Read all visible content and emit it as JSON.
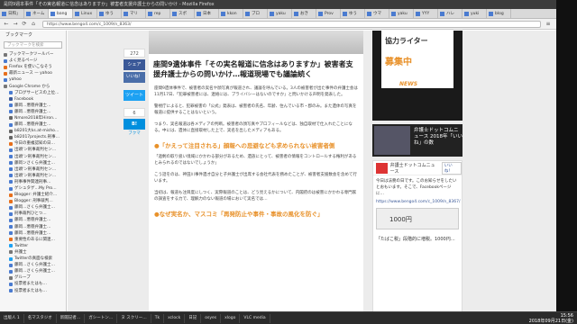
{
  "window": {
    "title": "是問9週本事件「その実名報道に信念はありますか」被害者支援弁護士からの問いかけ - Mozilla Firefox"
  },
  "tabs": [
    "日和」",
    "ネーム",
    "bang",
    "Linux",
    "ゆう",
    "マリ",
    "rep",
    "スポ",
    "日本",
    "kkon",
    "ブロ",
    "yaku",
    "おき",
    "Prov",
    "ゆう",
    "ウマ",
    "yaku",
    "YYY",
    "ハレ",
    "yuki",
    "blog"
  ],
  "nav": {
    "url": "https://www.bengo4.com/c_1009/n_8363/",
    "back": "←",
    "forward": "→",
    "reload": "⟳",
    "home": "⌂",
    "menu": "≡"
  },
  "sidebar": {
    "title": "ブックマーク",
    "search_placeholder": "ブックマークを検索",
    "items": [
      {
        "label": "ブックマークツールバー",
        "color": "#777"
      },
      {
        "label": "よく見るページ",
        "color": "#4a7bd0"
      },
      {
        "label": "Firefox を使いこなそう",
        "color": "#e76f1c"
      },
      {
        "label": "最新ニュース — yahoo",
        "color": "#e76f1c"
      },
      {
        "label": "yahoo",
        "color": "#4a7bd0"
      },
      {
        "label": "Google Chrome から",
        "color": "#777"
      },
      {
        "label": "ブログサービスの上位…",
        "color": "#4a7bd0"
      },
      {
        "label": "Facebook",
        "color": "#3b5998"
      },
      {
        "label": "藤岡…悪徳弁護士…",
        "color": "#4a7bd0"
      },
      {
        "label": "藤岡…悪徳弁護士…",
        "color": "#4a7bd0"
      },
      {
        "label": "Nmore2018年Hiron…",
        "color": "#666"
      },
      {
        "label": "藤岡…悪徳弁護士…",
        "color": "#4a7bd0"
      },
      {
        "label": "b8201大ks.at-misho…",
        "color": "#666"
      },
      {
        "label": "b82017projects.刑事…",
        "color": "#666"
      },
      {
        "label": "今日の重複認知の日…",
        "color": "#e76f1c"
      },
      {
        "label": "出頭'ン刑事裁判セン…",
        "color": "#4a7bd0"
      },
      {
        "label": "出頭'ン刑事裁判セン…",
        "color": "#4a7bd0"
      },
      {
        "label": "藤岡ンさくら弁護士…",
        "color": "#4a7bd0"
      },
      {
        "label": "出頭'ン刑事裁判セン…",
        "color": "#4a7bd0"
      },
      {
        "label": "出頭'ン刑事裁判セン…",
        "color": "#4a7bd0"
      },
      {
        "label": "刑事事件関連刑事…",
        "color": "#4a7bd0"
      },
      {
        "label": "ゲシュタゲ…My Pro…",
        "color": "#4a7bd0"
      },
      {
        "label": "Blogger: 弁護士紹介…",
        "color": "#e76f1c"
      },
      {
        "label": "Blogger: 刑事裁判…",
        "color": "#e76f1c"
      },
      {
        "label": "藤岡…さくら弁護士…",
        "color": "#4a7bd0"
      },
      {
        "label": "刑事裁判ひとつ…",
        "color": "#4a7bd0"
      },
      {
        "label": "藤岡…悪徳弁護士…",
        "color": "#4a7bd0"
      },
      {
        "label": "藤岡…悪徳弁護士…",
        "color": "#4a7bd0"
      },
      {
        "label": "藤岡…悪徳弁護士…",
        "color": "#4a7bd0"
      },
      {
        "label": "重要性のあるに関連…",
        "color": "#e76f1c"
      },
      {
        "label": "Twitter",
        "color": "#1da1f2"
      },
      {
        "label": "弁護士",
        "color": "#777"
      },
      {
        "label": "Twitterの真面な検索",
        "color": "#1da1f2"
      },
      {
        "label": "藤岡…さくら弁護士…",
        "color": "#4a7bd0"
      },
      {
        "label": "藤岡…さくら弁護士…",
        "color": "#4a7bd0"
      },
      {
        "label": "グループ",
        "color": "#777"
      },
      {
        "label": "投票者またはも…",
        "color": "#4a7bd0"
      },
      {
        "label": "投票者またはも…",
        "color": "#4a7bd0"
      }
    ]
  },
  "share": {
    "count": "272",
    "share_label": "シェア",
    "like_label": "いいね！",
    "tweet_label": "ツイート",
    "count2": "6",
    "hatena_label": "B!",
    "bookmark_label": "ブクマ"
  },
  "article": {
    "title": "座間9遺体事件「その実名報道に信念はありますか」被害者支援弁護士からの問いかけ…報道現場でも議論続く",
    "p1": "座間9遺体事件で、被害者の実名や顔写真が報道され、議論を呼んでいる。3人の被害者が出た事件の弁護士会は11月17日、「犯罪被害者には、連絡には、プライバシーはないのですか」と問いかける声明を発表した。",
    "p2": "警視庁によると、犯罪被害の「公式」発表は、被害者の氏名、年齢、住んでいる市・郡のみ。また遺体の写真を報道に提供することはないという。",
    "p3": "つまり、実名報道は各メディアの判断。被害者の顔写真やプロフィールなどは、独自取材で仕入れたことになる。中には、遺体に直接取材した上で、実名を出したメディアもある。",
    "h1": "●「かえって注目される」顔報への忌避なども求められない被害者側",
    "p4": "「過剰の取り扱い境域にかかわる部分があるため、遺族にとって、被害者の情報をコントロールする権利があるとみられるのではないでしょうか」",
    "p5": "こう話をのは、神田川事件遺才自分と子弁護士が出席する会社代表を務めたことが、被害者支援数会を含めて行います。",
    "p6": "当初は、報道も注目度にしつく、実際報道のことは、どう見えるかについて、内閣府のは被害にかかわる専門家の調査をする力で、理解力のない報道の場において実名では…",
    "h2": "●なぜ実名か、マスコミ「再発防止や事件・事故の風化を防ぐ」"
  },
  "ad": {
    "t1": "協力ライター",
    "t2": "募集中",
    "news": "NEWS",
    "banner": "弁護士ドットコムニュース 2018年「いいね」の数",
    "fb_name": "弁護士ドットコムニュース",
    "fb_like": "いいね！",
    "fb_text": "今日は法務の日です。このお知らせをしたいとおもいます。そこで、Facebookページに…",
    "fb_link": "https://www.bengo4.com/c_1009/n_8367/",
    "fb_img": "1000円",
    "fb_cap": "「たばこ税」段階的に増税。1000円…"
  },
  "taskbar": {
    "items": [
      "出版人 1",
      "名マスタジオ",
      "新聞記者…",
      "ガシートン…",
      "ヌ スクリー…",
      "Tk",
      "xclock",
      "日記",
      "osyes",
      "xlogo",
      "VLC media"
    ],
    "time": "15:56",
    "date": "2018年09月21日(金)"
  }
}
